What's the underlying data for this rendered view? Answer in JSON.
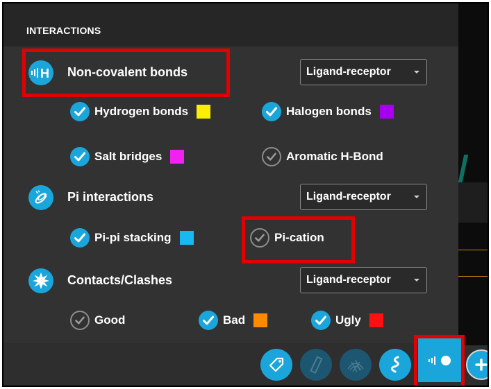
{
  "panel": {
    "header_title": "INTERACTIONS"
  },
  "sections": {
    "noncovalent": {
      "title": "Non-covalent bonds",
      "icon": "non-covalent-bonds-icon",
      "dropdown": "Ligand-receptor",
      "options": [
        {
          "label": "Hydrogen bonds",
          "checked": true,
          "swatch": "#f8f000"
        },
        {
          "label": "Halogen bonds",
          "checked": true,
          "swatch": "#a700ee"
        },
        {
          "label": "Salt bridges",
          "checked": true,
          "swatch": "#ef22ef"
        },
        {
          "label": "Aromatic H-Bond",
          "checked": false,
          "swatch": null
        }
      ]
    },
    "pi": {
      "title": "Pi interactions",
      "icon": "pi-interactions-icon",
      "dropdown": "Ligand-receptor",
      "options": [
        {
          "label": "Pi-pi stacking",
          "checked": true,
          "swatch": "#18b8f0"
        },
        {
          "label": "Pi-cation",
          "checked": false,
          "swatch": null
        }
      ]
    },
    "contacts": {
      "title": "Contacts/Clashes",
      "icon": "contacts-clashes-icon",
      "dropdown": "Ligand-receptor",
      "options": [
        {
          "label": "Good",
          "checked": false,
          "swatch": null
        },
        {
          "label": "Bad",
          "checked": true,
          "swatch": "#ff8a00"
        },
        {
          "label": "Ugly",
          "checked": true,
          "swatch": "#ff1010"
        }
      ]
    }
  },
  "toolbar": {
    "buttons": [
      {
        "icon": "label-tag-icon",
        "enabled": true
      },
      {
        "icon": "ruler-icon",
        "enabled": false
      },
      {
        "icon": "surface-mesh-icon",
        "enabled": false
      },
      {
        "icon": "ribbon-icon",
        "enabled": true
      },
      {
        "icon": "interactions-toggle-icon",
        "enabled": true
      },
      {
        "icon": "add-icon",
        "enabled": true
      }
    ]
  },
  "colors": {
    "accent": "#1ba6db",
    "highlight_box": "#e20000",
    "panel_bg": "#323232",
    "header_bg": "#262626"
  }
}
